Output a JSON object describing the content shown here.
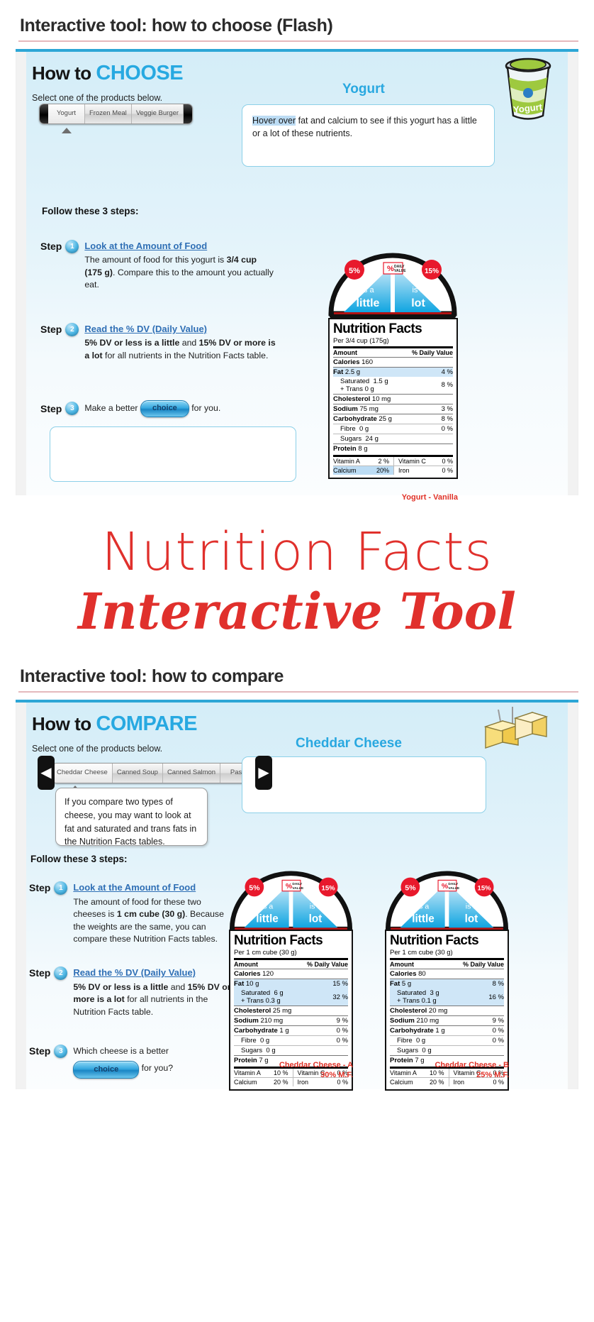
{
  "choose_panel": {
    "title": "Interactive tool: how to choose (Flash)",
    "howto_prefix": "How to ",
    "howto_accent": "CHOOSE",
    "select_label": "Select one of the products below.",
    "selector": {
      "tabs": [
        "Yogurt",
        "Frozen Meal",
        "Veggie Burger"
      ],
      "selected_index": 0
    },
    "product_name": "Yogurt",
    "bubble": {
      "hilite": "Hover over",
      "rest": " fat and calcium to see if this yogurt has a little or a lot of these nutrients."
    },
    "follow_label": "Follow these 3 steps:",
    "steps": [
      {
        "word": "Step",
        "num": "1",
        "head": "Look at the Amount of Food",
        "body_parts": [
          {
            "t": "The amount of food for this yogurt is ",
            "b": false
          },
          {
            "t": "3/4 cup (175 g)",
            "b": true
          },
          {
            "t": ". Compare this to the amount you actually eat.",
            "b": false
          }
        ]
      },
      {
        "word": "Step",
        "num": "2",
        "head": "Read the % DV (Daily Value)",
        "body_parts": [
          {
            "t": "5% DV or less is a little",
            "b": true
          },
          {
            "t": " and ",
            "b": false
          },
          {
            "t": "15% DV or more is a lot",
            "b": true
          },
          {
            "t": " for all nutrients in the Nutrition Facts table.",
            "b": false
          }
        ]
      },
      {
        "word": "Step",
        "num": "3",
        "head": "",
        "before_button": "Make a better ",
        "button": "choice",
        "after_button": " for you."
      }
    ],
    "dome": {
      "left_pct": "5%",
      "left_line1": "is a",
      "left_line2": "little",
      "right_pct": "15%",
      "right_line1": "is a",
      "right_line2": "lot",
      "badge_line1": "DAILY",
      "badge_line2": "VALUE",
      "badge_symbol": "%"
    },
    "nft": {
      "title": "Nutrition Facts",
      "per": "Per 3/4 cup (175g)",
      "amount_header": "Amount",
      "dv_header": "% Daily Value",
      "rows": [
        {
          "label": "Calories",
          "value": "160",
          "dv": "",
          "bold": true,
          "indent": false,
          "hl": false
        },
        {
          "label": "Fat",
          "value": "2.5 g",
          "dv": "4 %",
          "bold": true,
          "indent": false,
          "hl": true
        },
        {
          "label": "Saturated",
          "value": "1.5 g",
          "dv": "8 %",
          "bold": false,
          "indent": true,
          "hl": false,
          "sub": "+ Trans  0 g"
        },
        {
          "label": "Cholesterol",
          "value": "10 mg",
          "dv": "",
          "bold": true,
          "indent": false,
          "hl": false
        },
        {
          "label": "Sodium",
          "value": "75 mg",
          "dv": "3 %",
          "bold": true,
          "indent": false,
          "hl": false
        },
        {
          "label": "Carbohydrate",
          "value": "25 g",
          "dv": "8 %",
          "bold": true,
          "indent": false,
          "hl": false
        },
        {
          "label": "Fibre",
          "value": "0 g",
          "dv": "0 %",
          "bold": false,
          "indent": true,
          "hl": false
        },
        {
          "label": "Sugars",
          "value": "24 g",
          "dv": "",
          "bold": false,
          "indent": true,
          "hl": false
        },
        {
          "label": "Protein",
          "value": "8 g",
          "dv": "",
          "bold": true,
          "indent": false,
          "hl": false
        }
      ],
      "vitamins": [
        {
          "l1": "Vitamin A",
          "v1": "2 %",
          "hl1": false,
          "l2": "Vitamin C",
          "v2": "0 %",
          "hl2": false
        },
        {
          "l1": "Calcium",
          "v1": "20%",
          "hl1": true,
          "l2": "Iron",
          "v2": "0 %",
          "hl2": false
        }
      ],
      "caption": "Yogurt - Vanilla"
    }
  },
  "big_title": {
    "line1": "Nutrition Facts",
    "line2": "Interactive Tool"
  },
  "compare_panel": {
    "title": "Interactive tool: how to compare",
    "howto_prefix": "How to ",
    "howto_accent": "COMPARE",
    "select_label": "Select one of the products below.",
    "selector": {
      "tabs": [
        "Cheddar Cheese",
        "Canned Soup",
        "Canned Salmon",
        "Pasta"
      ],
      "selected_index": 0
    },
    "prev_arrow": "◀",
    "next_arrow": "▶",
    "product_name": "Cheddar Cheese",
    "tip": "If you compare two types of cheese, you may want to look at fat and saturated and trans fats in the Nutrition Facts tables.",
    "follow_label": "Follow these 3 steps:",
    "steps": [
      {
        "word": "Step",
        "num": "1",
        "head": "Look at the Amount of Food",
        "body_parts": [
          {
            "t": "The amount of food for these two cheeses is ",
            "b": false
          },
          {
            "t": "1 cm cube (30 g)",
            "b": true
          },
          {
            "t": ". Because the weights are the same, you can compare these Nutrition Facts tables.",
            "b": false
          }
        ]
      },
      {
        "word": "Step",
        "num": "2",
        "head": "Read the % DV (Daily Value)",
        "body_parts": [
          {
            "t": "5% DV or less is a little",
            "b": true
          },
          {
            "t": " and ",
            "b": false
          },
          {
            "t": "15% DV or more is a lot",
            "b": true
          },
          {
            "t": " for all nutrients in the Nutrition Facts table.",
            "b": false
          }
        ]
      },
      {
        "word": "Step",
        "num": "3",
        "head": "",
        "before_button": "Which cheese is a better ",
        "button": "choice",
        "after_button": " for you?"
      }
    ],
    "dome": {
      "left_pct": "5%",
      "left_line1": "is a",
      "left_line2": "little",
      "right_pct": "15%",
      "right_line1": "is a",
      "right_line2": "lot",
      "badge_line1": "DAILY",
      "badge_line2": "VALUE",
      "badge_symbol": "%"
    },
    "nft_a": {
      "title": "Nutrition Facts",
      "per": "Per 1 cm cube (30 g)",
      "amount_header": "Amount",
      "dv_header": "% Daily Value",
      "rows": [
        {
          "label": "Calories",
          "value": "120",
          "dv": "",
          "bold": true,
          "indent": false,
          "hl": false
        },
        {
          "label": "Fat",
          "value": "10 g",
          "dv": "15 %",
          "bold": true,
          "indent": false,
          "hl": true
        },
        {
          "label": "Saturated",
          "value": "6 g",
          "dv": "32 %",
          "bold": false,
          "indent": true,
          "hl": true,
          "sub": "+ Trans   0.3 g"
        },
        {
          "label": "Cholesterol",
          "value": "25 mg",
          "dv": "",
          "bold": true,
          "indent": false,
          "hl": false
        },
        {
          "label": "Sodium",
          "value": "210 mg",
          "dv": "9 %",
          "bold": true,
          "indent": false,
          "hl": false
        },
        {
          "label": "Carbohydrate",
          "value": "1 g",
          "dv": "0 %",
          "bold": true,
          "indent": false,
          "hl": false
        },
        {
          "label": "Fibre",
          "value": "0 g",
          "dv": "0 %",
          "bold": false,
          "indent": true,
          "hl": false
        },
        {
          "label": "Sugars",
          "value": "0 g",
          "dv": "",
          "bold": false,
          "indent": true,
          "hl": false
        },
        {
          "label": "Protein",
          "value": "7 g",
          "dv": "",
          "bold": true,
          "indent": false,
          "hl": false
        }
      ],
      "vitamins": [
        {
          "l1": "Vitamin A",
          "v1": "10 %",
          "hl1": false,
          "l2": "Vitamin C",
          "v2": "0 %",
          "hl2": false
        },
        {
          "l1": "Calcium",
          "v1": "20 %",
          "hl1": false,
          "l2": "Iron",
          "v2": "0 %",
          "hl2": false
        }
      ],
      "caption_line1": "Cheddar Cheese - A",
      "caption_line2": "30% M.F."
    },
    "nft_b": {
      "title": "Nutrition Facts",
      "per": "Per 1 cm cube (30 g)",
      "amount_header": "Amount",
      "dv_header": "% Daily Value",
      "rows": [
        {
          "label": "Calories",
          "value": "80",
          "dv": "",
          "bold": true,
          "indent": false,
          "hl": false
        },
        {
          "label": "Fat",
          "value": "5 g",
          "dv": "8 %",
          "bold": true,
          "indent": false,
          "hl": true
        },
        {
          "label": "Saturated",
          "value": "3 g",
          "dv": "16 %",
          "bold": false,
          "indent": true,
          "hl": true,
          "sub": "+ Trans   0.1 g"
        },
        {
          "label": "Cholesterol",
          "value": "20 mg",
          "dv": "",
          "bold": true,
          "indent": false,
          "hl": false
        },
        {
          "label": "Sodium",
          "value": "210 mg",
          "dv": "9 %",
          "bold": true,
          "indent": false,
          "hl": false
        },
        {
          "label": "Carbohydrate",
          "value": "1 g",
          "dv": "0 %",
          "bold": true,
          "indent": false,
          "hl": false
        },
        {
          "label": "Fibre",
          "value": "0 g",
          "dv": "0 %",
          "bold": false,
          "indent": true,
          "hl": false
        },
        {
          "label": "Sugars",
          "value": "0 g",
          "dv": "",
          "bold": false,
          "indent": true,
          "hl": false
        },
        {
          "label": "Protein",
          "value": "7 g",
          "dv": "",
          "bold": true,
          "indent": false,
          "hl": false
        }
      ],
      "vitamins": [
        {
          "l1": "Vitamin A",
          "v1": "10 %",
          "hl1": false,
          "l2": "Vitamin C",
          "v2": "0 %",
          "hl2": false
        },
        {
          "l1": "Calcium",
          "v1": "20 %",
          "hl1": false,
          "l2": "Iron",
          "v2": "0 %",
          "hl2": false
        }
      ],
      "caption_line1": "Cheddar Cheese - B",
      "caption_line2": "25% M.F."
    }
  }
}
